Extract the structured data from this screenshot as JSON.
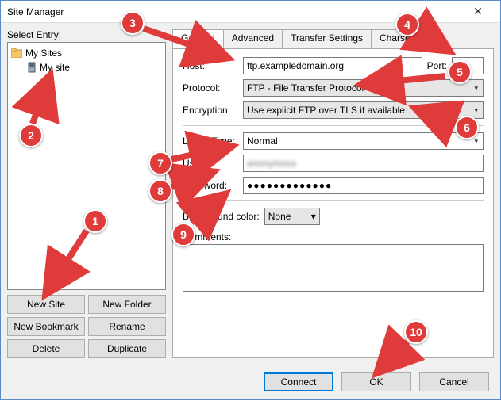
{
  "window": {
    "title": "Site Manager"
  },
  "left": {
    "select_label": "Select Entry:",
    "root_label": "My Sites",
    "site_label": "My site"
  },
  "buttons": {
    "new_site": "New Site",
    "new_folder": "New Folder",
    "new_bookmark": "New Bookmark",
    "rename": "Rename",
    "delete": "Delete",
    "duplicate": "Duplicate"
  },
  "tabs": {
    "general": "General",
    "advanced": "Advanced",
    "transfer": "Transfer Settings",
    "charset": "Charset"
  },
  "form": {
    "host_label": "Host:",
    "host_value": "ftp.exampledomain.org",
    "port_label": "Port:",
    "port_value": "21",
    "protocol_label": "Protocol:",
    "protocol_value": "FTP - File Transfer Protocol",
    "encryption_label": "Encryption:",
    "encryption_value": "Use explicit FTP over TLS if available",
    "logon_label": "Logon Type:",
    "logon_value": "Normal",
    "user_label": "User:",
    "user_value": "anonymous",
    "password_label": "Password:",
    "password_value": "●●●●●●●●●●●●●",
    "bgcolor_label": "Background color:",
    "bgcolor_value": "None",
    "comments_label": "Comments:"
  },
  "footer": {
    "connect": "Connect",
    "ok": "OK",
    "cancel": "Cancel"
  },
  "annotations": {
    "b1": "1",
    "b2": "2",
    "b3": "3",
    "b4": "4",
    "b5": "5",
    "b6": "6",
    "b7": "7",
    "b8": "8",
    "b9": "9",
    "b10": "10"
  }
}
